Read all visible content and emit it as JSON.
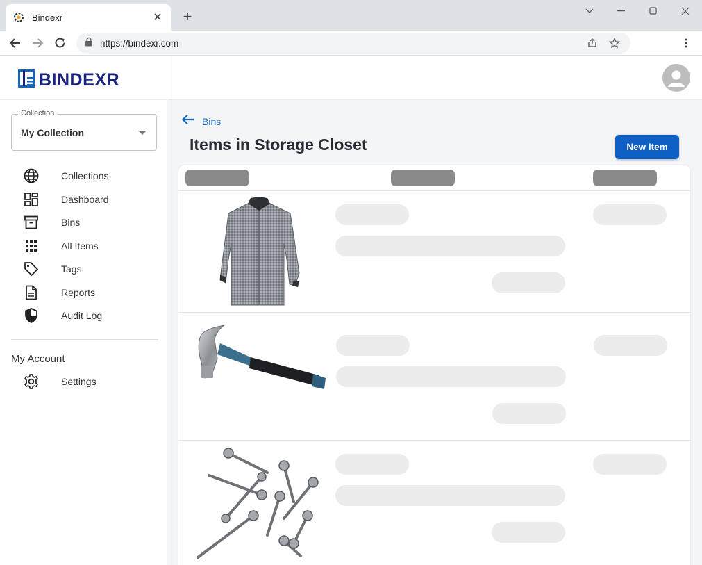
{
  "browser": {
    "tab_title": "Bindexr",
    "url": "https://bindexr.com"
  },
  "app": {
    "logo_text": "BINDEXR",
    "accent": "#1a237e",
    "primary": "#0d5fc4"
  },
  "sidebar": {
    "collection_legend": "Collection",
    "collection_value": "My Collection",
    "items": [
      {
        "label": "Collections",
        "icon": "globe-icon"
      },
      {
        "label": "Dashboard",
        "icon": "dashboard-icon"
      },
      {
        "label": "Bins",
        "icon": "archive-icon"
      },
      {
        "label": "All Items",
        "icon": "grid-icon"
      },
      {
        "label": "Tags",
        "icon": "tag-icon"
      },
      {
        "label": "Reports",
        "icon": "document-icon"
      },
      {
        "label": "Audit Log",
        "icon": "shield-icon"
      }
    ],
    "account_heading": "My Account",
    "account_items": [
      {
        "label": "Settings",
        "icon": "gear-icon"
      }
    ]
  },
  "main": {
    "back_label": "Bins",
    "title": "Items in Storage Closet",
    "new_button": "New Item",
    "rows": [
      {
        "image": "shirt"
      },
      {
        "image": "hammer"
      },
      {
        "image": "screws"
      }
    ]
  }
}
